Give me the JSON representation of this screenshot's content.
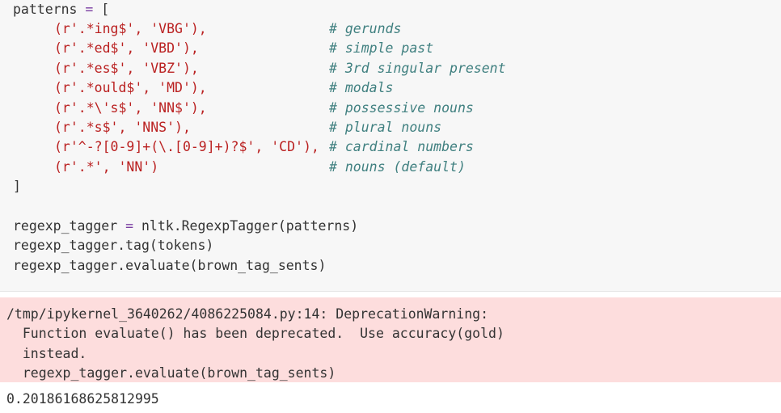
{
  "code": {
    "header": {
      "name": "patterns",
      "op": "=",
      "bracket": "["
    },
    "patterns": [
      {
        "code": "(r'.*ing$', 'VBG'),",
        "comment": "# gerunds"
      },
      {
        "code": "(r'.*ed$', 'VBD'),",
        "comment": "# simple past"
      },
      {
        "code": "(r'.*es$', 'VBZ'),",
        "comment": "# 3rd singular present"
      },
      {
        "code": "(r'.*ould$', 'MD'),",
        "comment": "# modals"
      },
      {
        "code": "(r'.*\\'s$', 'NN$'),",
        "comment": "# possessive nouns"
      },
      {
        "code": "(r'.*s$', 'NNS'),",
        "comment": "# plural nouns"
      },
      {
        "code": "(r'^-?[0-9]+(\\.[0-9]+)?$', 'CD'),",
        "comment": "# cardinal numbers"
      },
      {
        "code": "(r'.*', 'NN')",
        "comment": "# nouns (default)"
      }
    ],
    "close_bracket": "]",
    "line_assign": {
      "lhs": "regexp_tagger",
      "op": "=",
      "rhs": "nltk.RegexpTagger(patterns)"
    },
    "line_tag": "regexp_tagger.tag(tokens)",
    "line_evaluate": "regexp_tagger.evaluate(brown_tag_sents)"
  },
  "stderr": {
    "lines": [
      "/tmp/ipykernel_3640262/4086225084.py:14: DeprecationWarning:",
      "  Function evaluate() has been deprecated.  Use accuracy(gold)",
      "  instead.",
      "  regexp_tagger.evaluate(brown_tag_sents)"
    ]
  },
  "result": {
    "value": "0.20186168625812995"
  }
}
